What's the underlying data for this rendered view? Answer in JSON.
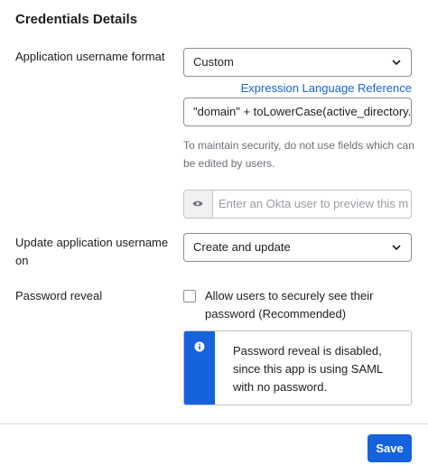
{
  "section": {
    "title": "Credentials Details"
  },
  "username_format": {
    "label": "Application username format",
    "selected": "Custom",
    "link": "Expression Language Reference",
    "expression_value": "\"domain\" + toLowerCase(active_directory.s",
    "hint": "To maintain security, do not use fields which can be edited by users.",
    "preview_placeholder": "Enter an Okta user to preview this m"
  },
  "update_on": {
    "label": "Update application username on",
    "selected": "Create and update"
  },
  "password_reveal": {
    "label": "Password reveal",
    "checkbox_label": "Allow users to securely see their password (Recommended)",
    "checked": false,
    "callout": "Password reveal is disabled, since this app is using SAML with no password."
  },
  "footer": {
    "save_label": "Save"
  },
  "colors": {
    "accent": "#1662dd",
    "text": "#1d1d21",
    "muted": "#6e6e78"
  }
}
